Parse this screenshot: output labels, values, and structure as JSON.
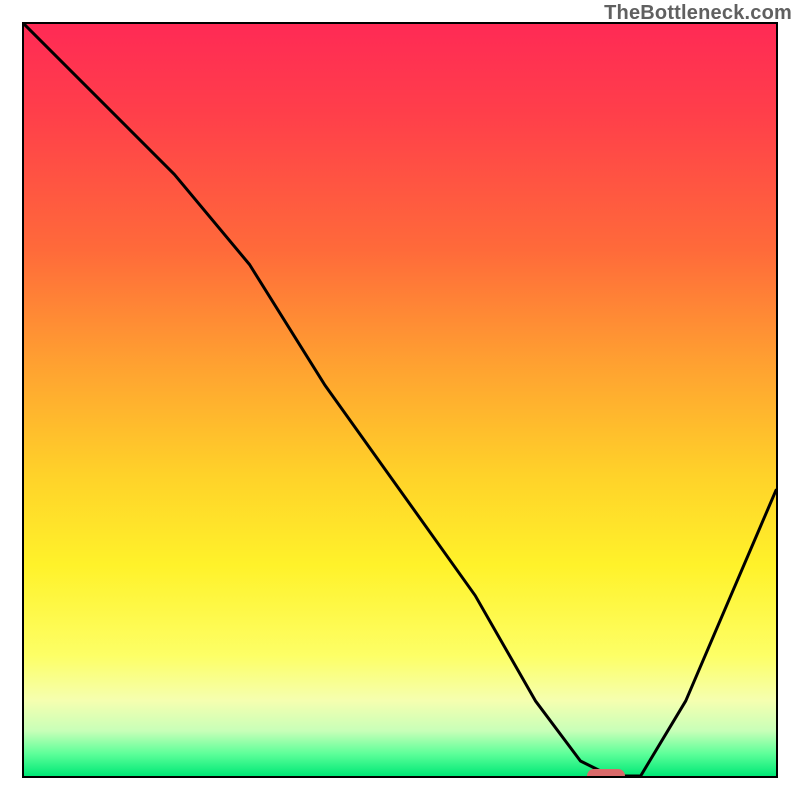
{
  "watermark": "TheBottleneck.com",
  "colors": {
    "curve": "#000000",
    "marker": "#d96a6a",
    "border": "#000000",
    "gradient_top": "#ff2a55",
    "gradient_bottom": "#00e876"
  },
  "chart_data": {
    "type": "line",
    "title": "",
    "xlabel": "",
    "ylabel": "",
    "xlim": [
      0,
      100
    ],
    "ylim": [
      0,
      100
    ],
    "background_gradient": {
      "direction": "vertical",
      "stops": [
        {
          "pos": 0,
          "color": "#ff2a55"
        },
        {
          "pos": 30,
          "color": "#ff6a3a"
        },
        {
          "pos": 60,
          "color": "#ffd229"
        },
        {
          "pos": 84,
          "color": "#fdff66"
        },
        {
          "pos": 97,
          "color": "#5fff9a"
        },
        {
          "pos": 100,
          "color": "#00e876"
        }
      ]
    },
    "series": [
      {
        "name": "bottleneck-curve",
        "x": [
          0,
          8,
          20,
          30,
          40,
          50,
          60,
          68,
          74,
          78,
          82,
          88,
          94,
          100
        ],
        "y": [
          100,
          92,
          80,
          68,
          52,
          38,
          24,
          10,
          2,
          0,
          0,
          10,
          24,
          38
        ]
      }
    ],
    "annotations": [
      {
        "type": "pill-marker",
        "name": "optimum-marker",
        "x": 77,
        "y": 0.5,
        "color": "#d96a6a"
      }
    ]
  }
}
